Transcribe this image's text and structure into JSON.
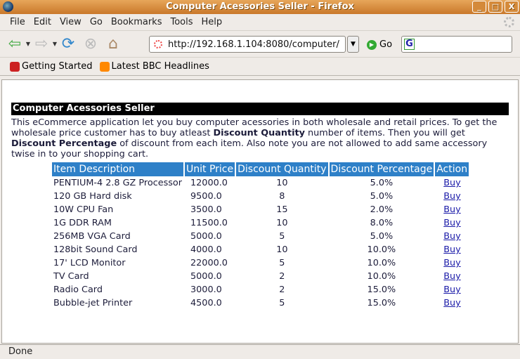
{
  "window": {
    "title": "Computer Acessories Seller - Firefox",
    "min": "_",
    "max": "□",
    "close": "X"
  },
  "menu": [
    "File",
    "Edit",
    "View",
    "Go",
    "Bookmarks",
    "Tools",
    "Help"
  ],
  "nav": {
    "url": "http://192.168.1.104:8080/computer/",
    "go": "Go"
  },
  "bookmarks": [
    "Getting Started",
    "Latest BBC Headlines"
  ],
  "page": {
    "heading": "Computer Acessories Seller",
    "desc1": "This eCommerce application let you buy computer acessories in both wholesale and retail prices. To get the wholesale price customer has to buy atleast ",
    "bold1": "Discount Quantity",
    "desc2": " number of items. Then you will get ",
    "bold2": "Discount Percentage",
    "desc3": " of discount from each item. Also note you are not allowed to add same accessory twise in to your shopping cart.",
    "columns": [
      "Item Description",
      "Unit Price",
      "Discount Quantity",
      "Discount Percentage",
      "Action"
    ],
    "rows": [
      [
        "PENTIUM-4 2.8 GZ Processor",
        "12000.0",
        "10",
        "5.0%",
        "Buy"
      ],
      [
        "120 GB Hard disk",
        "9500.0",
        "8",
        "5.0%",
        "Buy"
      ],
      [
        "10W CPU Fan",
        "3500.0",
        "15",
        "2.0%",
        "Buy"
      ],
      [
        "1G DDR RAM",
        "11500.0",
        "10",
        "8.0%",
        "Buy"
      ],
      [
        "256MB VGA Card",
        "5000.0",
        "5",
        "5.0%",
        "Buy"
      ],
      [
        "128bit Sound Card",
        "4000.0",
        "10",
        "10.0%",
        "Buy"
      ],
      [
        "17' LCD Monitor",
        "22000.0",
        "5",
        "10.0%",
        "Buy"
      ],
      [
        "TV Card",
        "5000.0",
        "2",
        "10.0%",
        "Buy"
      ],
      [
        "Radio Card",
        "3000.0",
        "2",
        "15.0%",
        "Buy"
      ],
      [
        "Bubble-jet Printer",
        "4500.0",
        "5",
        "15.0%",
        "Buy"
      ]
    ]
  },
  "status": "Done"
}
